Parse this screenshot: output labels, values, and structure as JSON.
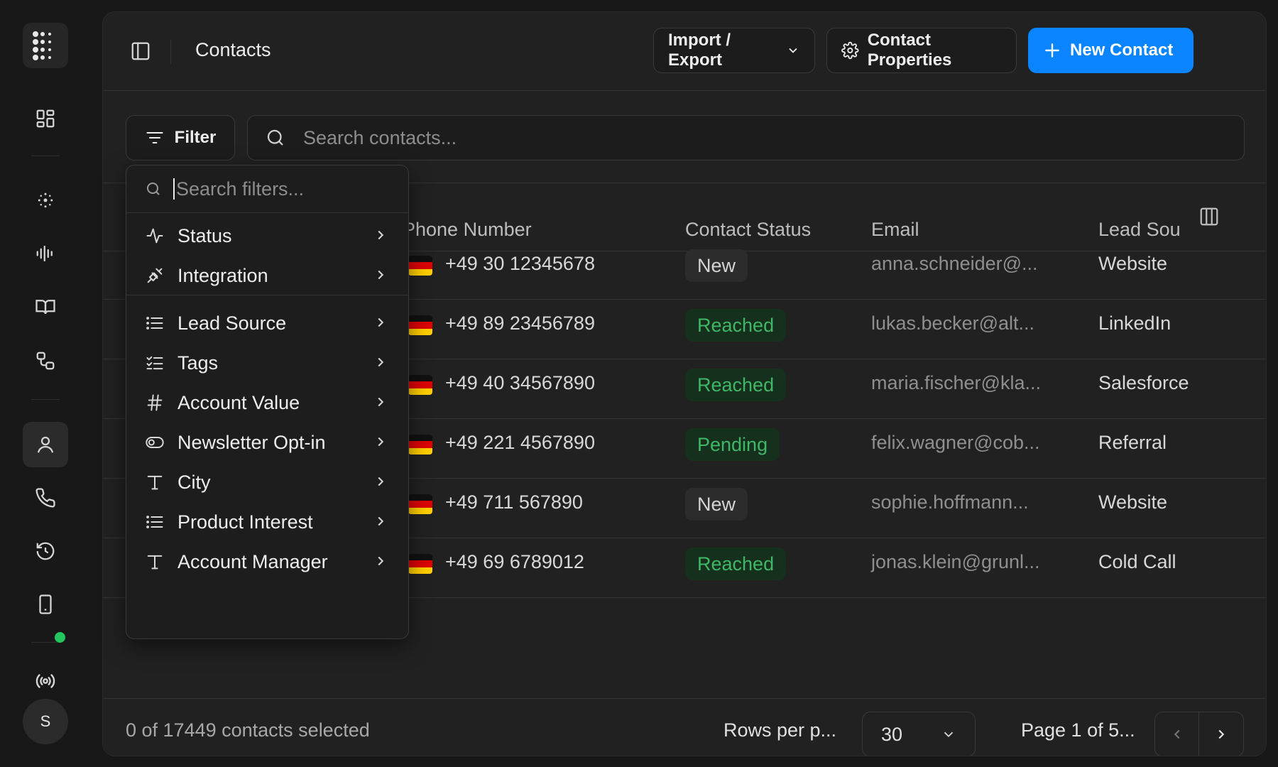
{
  "header": {
    "title": "Contacts",
    "import_export": "Import / Export",
    "contact_properties": "Contact Properties",
    "new_contact": "New Contact"
  },
  "toolbar": {
    "filter": "Filter",
    "search_placeholder": "Search contacts..."
  },
  "filter_menu": {
    "search_placeholder": "Search filters...",
    "items": [
      {
        "label": "Status",
        "icon": "activity-icon"
      },
      {
        "label": "Integration",
        "icon": "plug-icon"
      },
      {
        "label": "Lead Source",
        "icon": "list-icon"
      },
      {
        "label": "Tags",
        "icon": "checklist-icon"
      },
      {
        "label": "Account Value",
        "icon": "hash-icon"
      },
      {
        "label": "Newsletter Opt-in",
        "icon": "toggle-icon"
      },
      {
        "label": "City",
        "icon": "text-icon"
      },
      {
        "label": "Product Interest",
        "icon": "list-icon"
      },
      {
        "label": "Account Manager",
        "icon": "text-icon"
      }
    ]
  },
  "table": {
    "columns": [
      "Phone Number",
      "Contact Status",
      "Email",
      "Lead Sou"
    ],
    "rows": [
      {
        "phone": "+49 30 12345678",
        "status": "New",
        "email": "anna.schneider@...",
        "lead": "Website"
      },
      {
        "phone": "+49 89 23456789",
        "status": "Reached",
        "email": "lukas.becker@alt...",
        "lead": "LinkedIn"
      },
      {
        "phone": "+49 40 34567890",
        "status": "Reached",
        "email": "maria.fischer@kla...",
        "lead": "Salesforce"
      },
      {
        "phone": "+49 221 4567890",
        "status": "Pending",
        "email": "felix.wagner@cob...",
        "lead": "Referral"
      },
      {
        "phone": "+49 711 567890",
        "status": "New",
        "email": "sophie.hoffmann...",
        "lead": "Website"
      },
      {
        "phone": "+49 69 6789012",
        "status": "Reached",
        "email": "jonas.klein@grunl...",
        "lead": "Cold Call"
      }
    ]
  },
  "footer": {
    "selected": "0 of 17449 contacts selected",
    "rows_per_page_label": "Rows per p...",
    "rows_per_page": "30",
    "page": "Page 1 of 5..."
  },
  "sidebar": {
    "avatar": "S"
  },
  "colors": {
    "accent": "#0a84ff",
    "status_green": "#3fb767",
    "online": "#22c55e"
  }
}
